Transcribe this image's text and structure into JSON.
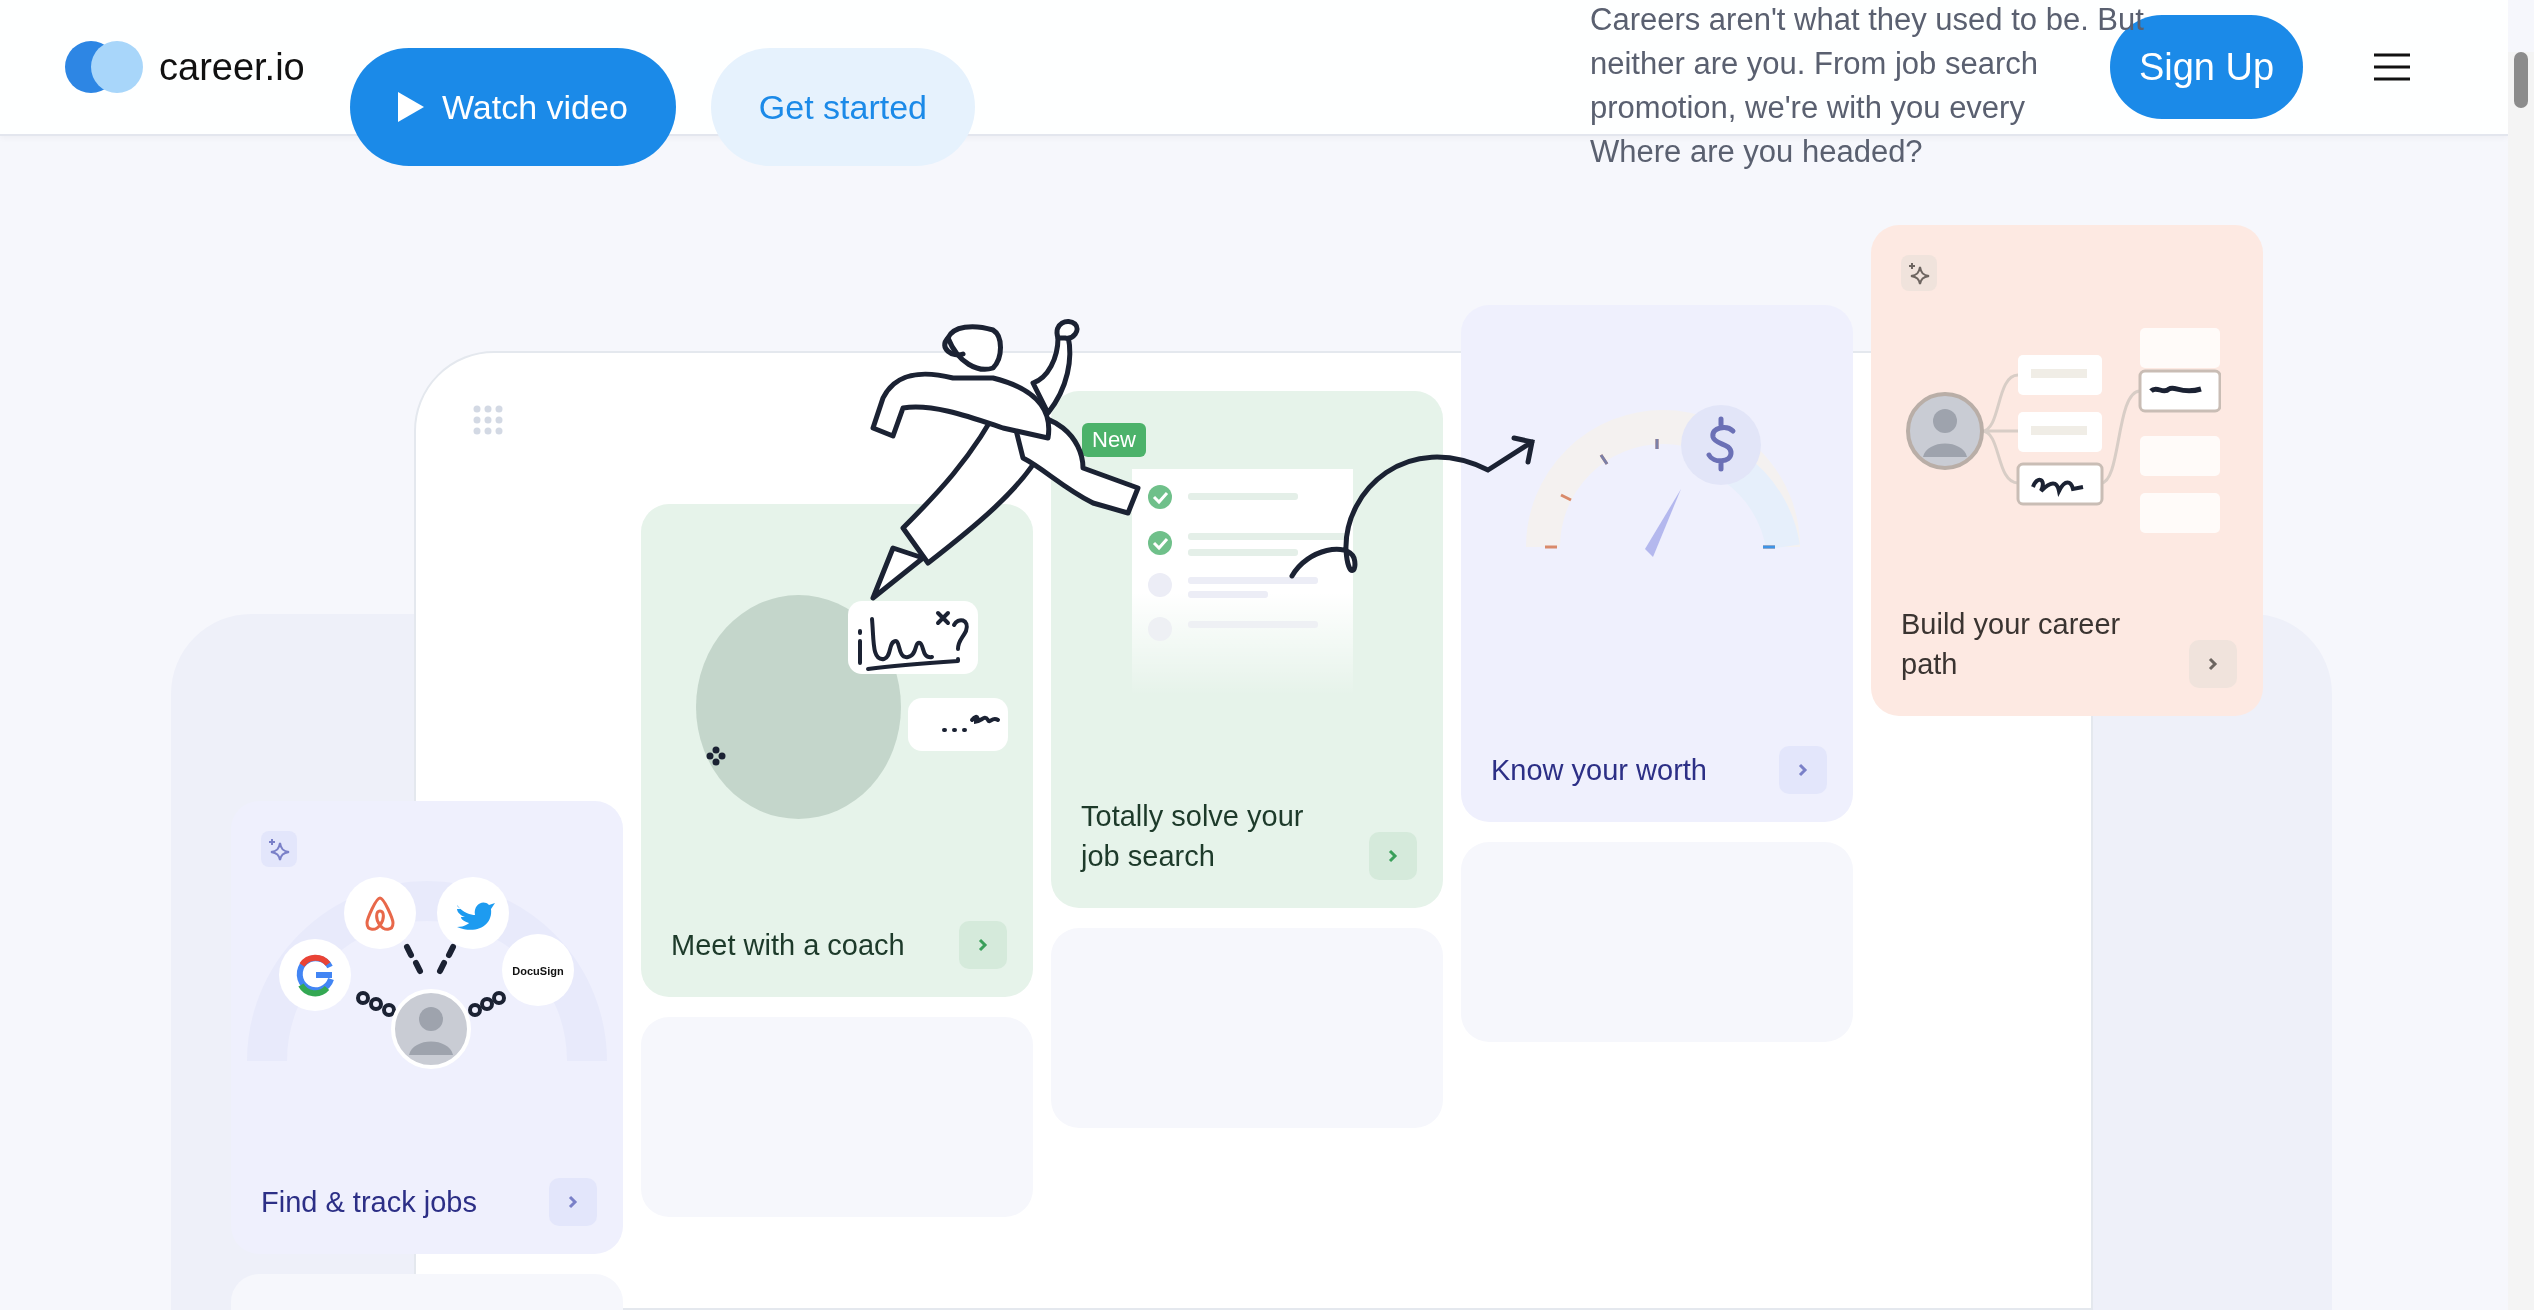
{
  "header": {
    "logo_text": "career.io",
    "sign_up": "Sign Up"
  },
  "hero": {
    "buttons": [
      {
        "label": "Watch video",
        "kind": "primary"
      },
      {
        "label": "Get started",
        "kind": "secondary"
      }
    ],
    "intro_lines": [
      "Careers aren't what they used to be. But",
      "neither are you. From job search",
      "promotion, we're with you every"
    ],
    "question": "Where are you headed?"
  },
  "cards": [
    {
      "title": "Find & track jobs",
      "kind": "companies",
      "color": "#eff0fd",
      "sparkle": true,
      "logo_text": "DocuSign"
    },
    {
      "title": "Meet with a coach",
      "kind": "coach",
      "color": "#e6f3ea",
      "sparkle": false
    },
    {
      "title": "Totally solve your job search",
      "kind": "checklist",
      "color": "#e6f3ea",
      "sparkle": false,
      "badge": "New"
    },
    {
      "title": "Know your worth",
      "kind": "gauge",
      "color": "#eff0fd",
      "sparkle": false
    },
    {
      "title": "Build your career path",
      "kind": "career-map",
      "color": "#fde9e2",
      "sparkle": true
    }
  ]
}
